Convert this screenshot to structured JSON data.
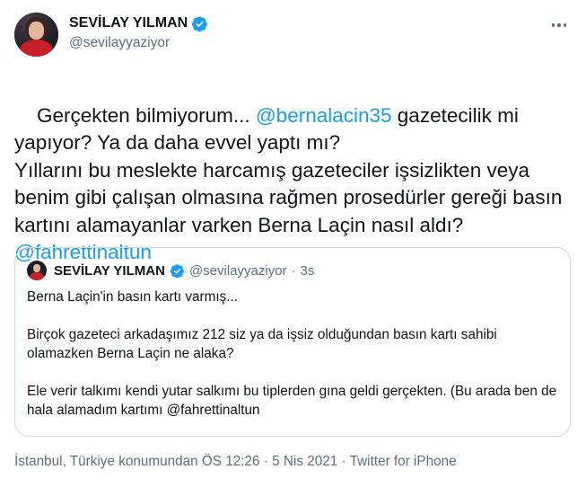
{
  "author": {
    "display_name": "SEVİLAY YILMAN",
    "handle": "@sevilayyaziyor",
    "verified": true
  },
  "tweet": {
    "segments": [
      {
        "type": "text",
        "text": "Gerçekten bilmiyorum... "
      },
      {
        "type": "mention",
        "text": "@bernalacin35"
      },
      {
        "type": "text",
        "text": " gazetecilik mi yapıyor? Ya da daha evvel yaptı mı?\nYıllarını bu meslekte harcamış gazeteciler işsizlikten veya benim gibi çalışan olmasına rağmen prosedürler gereği basın kartını alamayanlar varken Berna Laçin nasıl aldı? "
      },
      {
        "type": "mention",
        "text": "@fahrettinaltun"
      }
    ]
  },
  "quote": {
    "display_name": "SEVİLAY YILMAN",
    "handle": "@sevilayyaziyor",
    "separator": "·",
    "time": "3s",
    "paragraphs": [
      "Berna Laçin'in basın kartı varmış...",
      "Birçok gazeteci arkadaşımız 212 siz ya da işsiz olduğundan basın kartı sahibi olamazken Berna Laçin ne alaka?",
      "Ele verir talkımı kendi yutar salkımı bu tiplerden gına geldi gerçekten. (Bu arada ben de hala alamadım kartımı @fahrettinaltun"
    ]
  },
  "footer": {
    "location": "İstanbul, Türkiye konumundan",
    "time": "ÖS 12:26",
    "date": "5 Nis 2021",
    "source": "Twitter for iPhone",
    "separator": "·"
  },
  "colors": {
    "accent": "#1d9bf0",
    "secondary_text": "#5b7083",
    "border": "#cfd9de"
  },
  "icons": [
    "verified-badge-icon",
    "more-options-icon"
  ]
}
